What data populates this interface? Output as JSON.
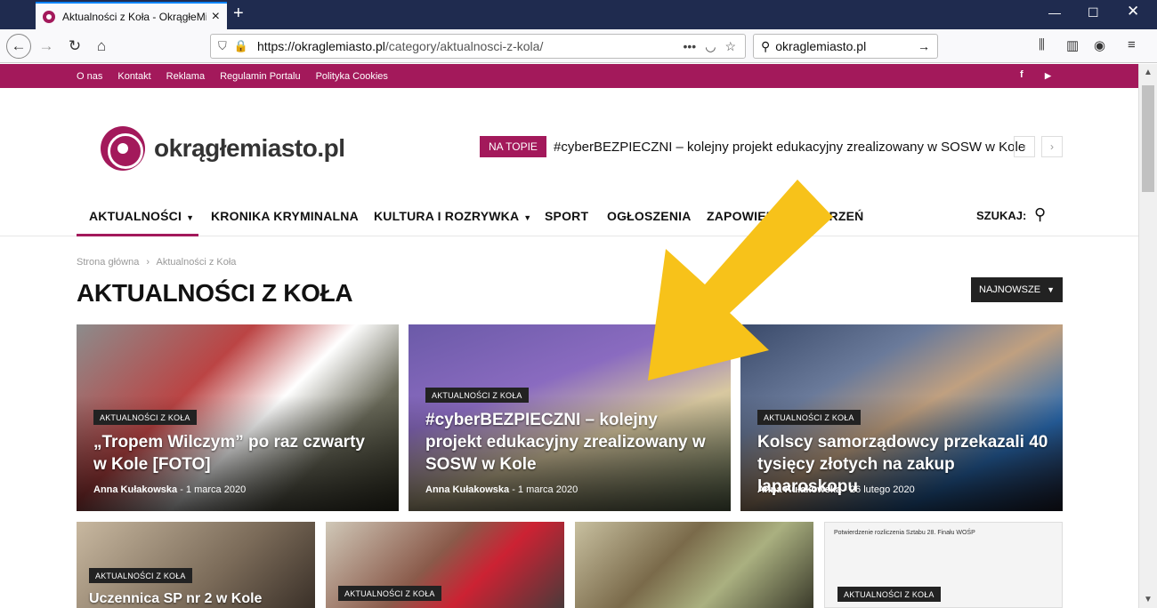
{
  "browser": {
    "tab_title": "Aktualności z Koła - OkrągłeMi",
    "url_host": "https://okraglemiasto.pl",
    "url_path": "/category/aktualnosci-z-kola/",
    "search_query": "okraglemiasto.pl"
  },
  "topbar": {
    "links": [
      "O nas",
      "Kontakt",
      "Reklama",
      "Regulamin Portalu",
      "Polityka Cookies"
    ],
    "social": [
      "f",
      "▶"
    ]
  },
  "header": {
    "logo_text": "okrągłemiasto.pl",
    "topic_badge": "NA TOPIE",
    "topic_text": "#cyberBEZPIECZNI – kolejny projekt edukacyjny zrealizowany w SOSW w Kole"
  },
  "nav": {
    "items": [
      "AKTUALNOŚCI",
      "KRONIKA KRYMINALNA",
      "KULTURA I ROZRYWKA",
      "SPORT",
      "OGŁOSZENIA",
      "ZAPOWIEDZI WYDARZEŃ"
    ],
    "search_label": "SZUKAJ:"
  },
  "breadcrumb": {
    "home": "Strona główna",
    "sep": "›",
    "current": "Aktualności z Koła"
  },
  "page": {
    "title": "AKTUALNOŚCI Z KOŁA",
    "sort_label": "NAJNOWSZE"
  },
  "featured": [
    {
      "category": "AKTUALNOŚCI Z KOŁA",
      "title": "„Tropem Wilczym” po raz czwarty w Kole [FOTO]",
      "author": "Anna Kułakowska",
      "date": "1 marca 2020",
      "color": "#7b3a3a"
    },
    {
      "category": "AKTUALNOŚCI Z KOŁA",
      "title": "#cyberBEZPIECZNI – kolejny projekt edukacyjny zrealizowany w SOSW w Kole",
      "author": "Anna Kułakowska",
      "date": "1 marca 2020",
      "color": "#5b4a8e"
    },
    {
      "category": "AKTUALNOŚCI Z KOŁA",
      "title": "Kolscy samorządowcy przekazali 40 tysięcy złotych na zakup laparoskopu",
      "author": "Anna Kułakowska",
      "date": "26 lutego 2020",
      "color": "#3c4b6b"
    }
  ],
  "secondary": [
    {
      "category": "AKTUALNOŚCI Z KOŁA",
      "title": "Uczennica SP nr 2 w Kole",
      "color": "#6e5a48"
    },
    {
      "category": "AKTUALNOŚCI Z KOŁA",
      "title": "",
      "color": "#6b4b3c"
    },
    {
      "category": "",
      "title": "",
      "color": "#8a7a5a"
    },
    {
      "category": "AKTUALNOŚCI Z KOŁA",
      "title": "",
      "color": "#e8e8e8",
      "doc_heading": "Potwierdzenie rozliczenia Sztabu 28. Finału WOŚP"
    }
  ],
  "annotation": {
    "arrow_color": "#f7c21a"
  }
}
